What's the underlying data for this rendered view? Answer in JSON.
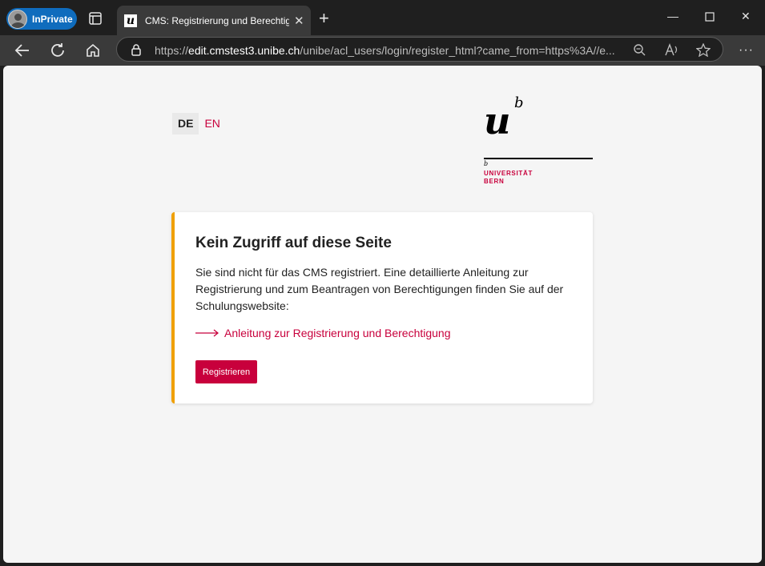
{
  "browser": {
    "inprivate_label": "InPrivate",
    "tab_title": "CMS: Registrierung und Berechtigung",
    "tab_favicon": "u",
    "url_prefix": "https://",
    "url_host": "edit.cmstest3.unibe.ch",
    "url_path": "/unibe/acl_users/login/register_html?came_from=https%3A//e...",
    "icons": [
      "tab-actions-icon",
      "close-icon",
      "new-tab-icon",
      "minimize-icon",
      "maximize-icon",
      "window-close-icon",
      "back-icon",
      "refresh-icon",
      "home-icon",
      "lock-icon",
      "zoom-icon",
      "read-aloud-icon",
      "favorite-icon",
      "more-icon"
    ]
  },
  "page": {
    "languages": [
      {
        "label": "DE",
        "active": true
      },
      {
        "label": "EN",
        "active": false
      }
    ],
    "logo": {
      "letter_u": "u",
      "letter_b": "b",
      "small_b": "b",
      "line1": "UNIVERSITÄT",
      "line2": "BERN"
    },
    "card": {
      "title": "Kein Zugriff auf diese Seite",
      "body": "Sie sind nicht für das CMS registriert. Eine detaillierte Anleitung zur Registrierung und zum Beantragen von Berechtigungen finden Sie auf der Schulungswebsite:",
      "link_text": "Anleitung zur Registrierung und Berechtigung",
      "button_label": "Registrieren"
    },
    "colors": {
      "accent": "#c8003c",
      "card_border": "#f0a000",
      "inprivate": "#0f6cbd"
    }
  }
}
